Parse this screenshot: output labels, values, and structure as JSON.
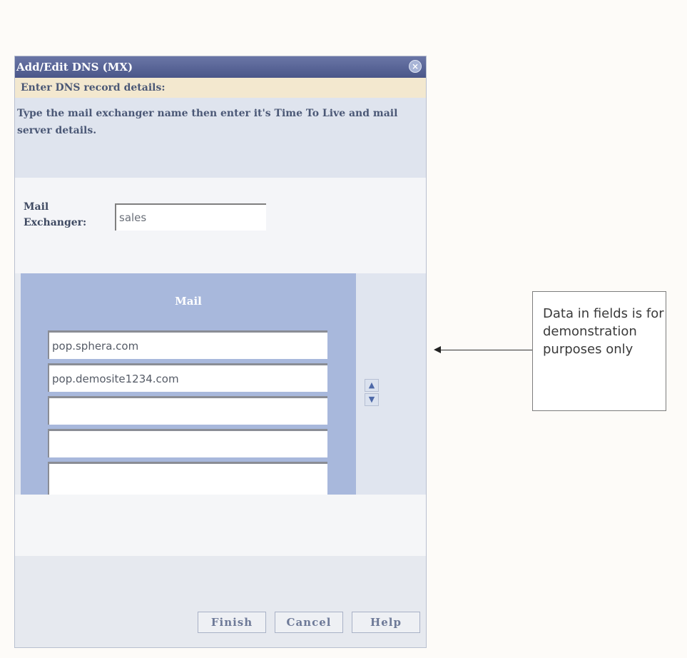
{
  "dialog": {
    "title": "Add/Edit DNS (MX)",
    "close_icon": "close-icon",
    "section_header": "Enter DNS record details:",
    "description": "Type the mail exchanger name then enter it's Time To Live and mail server details.",
    "mail_exchanger_label": "Mail Exchanger:",
    "mail_exchanger_value": "sales",
    "mail_header": "Mail",
    "mail_servers": [
      "pop.sphera.com",
      "pop.demosite1234.com",
      "",
      "",
      ""
    ],
    "move_up_icon": "arrow-up-icon",
    "move_down_icon": "arrow-down-icon",
    "buttons": {
      "finish": "Finish",
      "cancel": "Cancel",
      "help": "Help"
    }
  },
  "callout": {
    "text": "Data in fields is for demonstration purposes only"
  },
  "colors": {
    "titlebar": "#4a5689",
    "header_band": "#f3e8cf",
    "mail_panel": "#a8b8dc"
  }
}
